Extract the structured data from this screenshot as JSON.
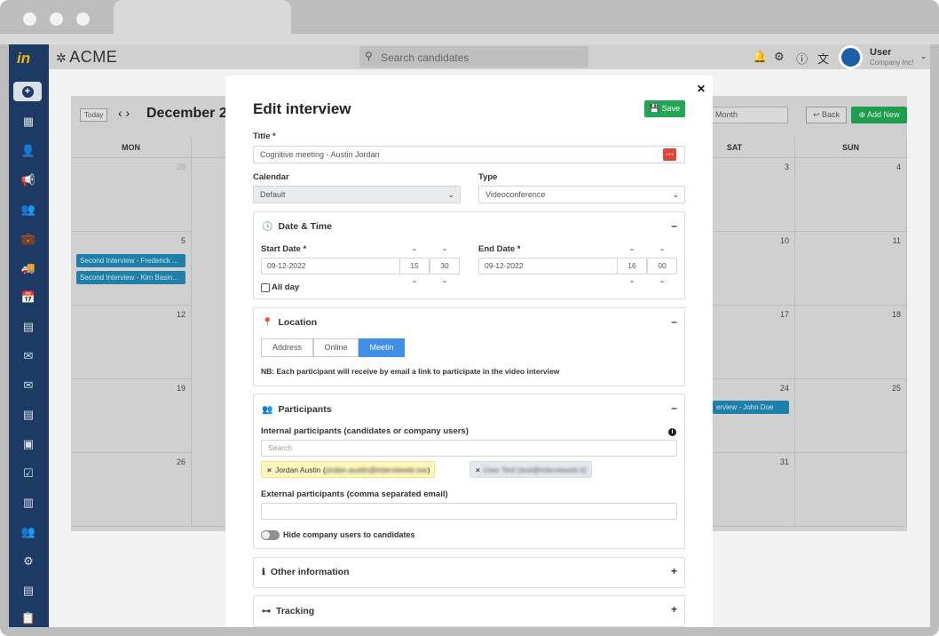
{
  "app": {
    "brand": "ACME",
    "search_placeholder": "Search candidates",
    "user_name": "User",
    "user_company": "Company Inc!"
  },
  "sidebar": {
    "icons": [
      "add-icon",
      "dashboard-icon",
      "search-user-icon",
      "megaphone-icon",
      "users-icon",
      "briefcase-icon",
      "truck-icon",
      "calendar-icon",
      "contact-card-icon",
      "mail-icon",
      "envelope-open-icon",
      "document-icon",
      "calendar-day-icon",
      "file-check-icon",
      "bar-chart-icon",
      "user-group-icon",
      "user-settings-icon",
      "file-icon",
      "clipboard-icon"
    ]
  },
  "calendar": {
    "today_label": "Today",
    "title": "December 2",
    "view": "Month",
    "back_label": "Back",
    "add_new_label": "Add New",
    "days": [
      "MON",
      "",
      "",
      "",
      "",
      "SAT",
      "SUN"
    ],
    "weeks": [
      {
        "mon": "28",
        "sat": "3",
        "sun": "4"
      },
      {
        "mon": "5",
        "sat": "10",
        "sun": "11"
      },
      {
        "mon": "12",
        "sat": "17",
        "sun": "18"
      },
      {
        "mon": "19",
        "sat": "24",
        "sun": "25"
      },
      {
        "mon": "26",
        "sat": "31",
        "sun": ""
      }
    ],
    "events": [
      "Second Interview - Frederick ...",
      "Second Interview - Kim Basin...",
      "erview - John Doe"
    ]
  },
  "modal": {
    "title": "Edit interview",
    "save_label": "Save",
    "title_label": "Title *",
    "title_value": "Cognitive meeting - Austin Jordan",
    "calendar_label": "Calendar",
    "calendar_value": "Default",
    "type_label": "Type",
    "type_value": "Videoconference",
    "datetime": {
      "title": "Date & Time",
      "start_label": "Start Date *",
      "start_date": "09-12-2022",
      "start_hour": "15",
      "start_min": "30",
      "end_label": "End Date *",
      "end_date": "09-12-2022",
      "end_hour": "16",
      "end_min": "00",
      "all_day_label": "All day"
    },
    "location": {
      "title": "Location",
      "options": [
        "Address",
        "Online",
        "Meetin"
      ],
      "selected": "Meetin",
      "note": "NB: Each participant will receive by email a link to participate in the video interview"
    },
    "participants": {
      "title": "Participants",
      "internal_label": "Internal participants (candidates or company users)",
      "search_placeholder": "Search",
      "tag1_name": "Jordan Austin (",
      "tag1_email": "jordan.austin@intervieweb.ivw",
      "tag1_close": ")",
      "tag2_name": "User Test (",
      "tag2_email": "test@intervieweb.it",
      "tag2_close": ")",
      "external_label": "External participants (comma separated email)",
      "hide_label": "Hide company users to candidates"
    },
    "other_info": {
      "title": "Other information"
    },
    "tracking": {
      "title": "Tracking"
    }
  }
}
